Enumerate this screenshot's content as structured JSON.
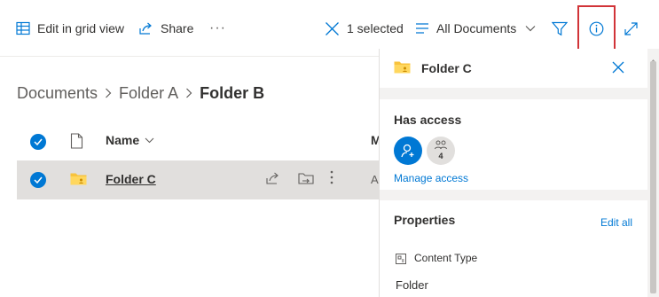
{
  "toolbar": {
    "edit_grid_label": "Edit in grid view",
    "share_label": "Share",
    "more_label": "···",
    "selected_label": "1 selected",
    "view_label": "All Documents",
    "accent_color": "#0078d4",
    "highlight_color": "#d13438",
    "icons": [
      "grid-icon",
      "share-icon",
      "more-icon",
      "close-selection-icon",
      "view-list-icon",
      "chevron-down-icon",
      "filter-icon",
      "info-icon",
      "expand-icon"
    ]
  },
  "breadcrumb": {
    "items": [
      "Documents",
      "Folder A"
    ],
    "current": "Folder B"
  },
  "list": {
    "columns": {
      "name": "Name",
      "modified": "M"
    },
    "rows": [
      {
        "name": "Folder C",
        "modified_truncated": "A",
        "selected": true,
        "type": "folder"
      }
    ]
  },
  "details": {
    "title": "Folder C",
    "has_access_title": "Has access",
    "group_count": "4",
    "manage_access_label": "Manage access",
    "properties_title": "Properties",
    "edit_all_label": "Edit all",
    "content_type_label": "Content Type",
    "content_type_value": "Folder"
  }
}
